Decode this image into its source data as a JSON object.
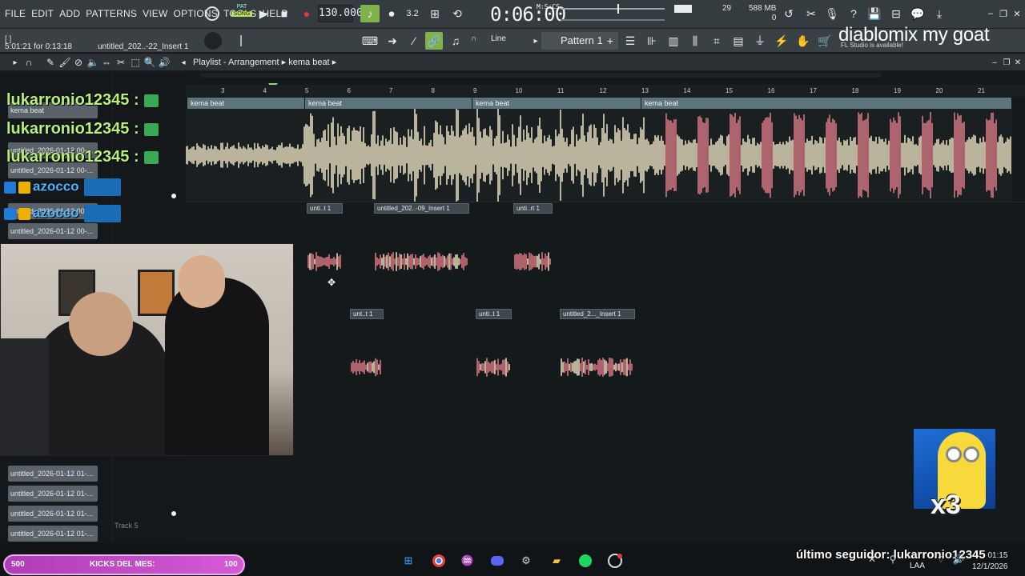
{
  "menu": [
    "FILE",
    "EDIT",
    "ADD",
    "PATTERNS",
    "VIEW",
    "OPTIONS",
    "TOOLS",
    "HELP"
  ],
  "transport": {
    "pat_label": "PAT",
    "song_label": "SONG",
    "tempo": "130.000",
    "time": "0:06:00",
    "time_unit": "M:S:CS"
  },
  "status": {
    "cpu": "29",
    "memory": "588 MB",
    "poly": "0"
  },
  "hint": {
    "line1": "[ ]",
    "line2": "5:01:21 for 0:13:18",
    "file": "untitled_202..-22_Insert 1"
  },
  "toolbar2": {
    "snap": "Line",
    "pattern": "Pattern 1"
  },
  "overlay": {
    "title": "diablomix my goat",
    "update_note": "FL Studio is available!"
  },
  "playlist": {
    "breadcrumb": "Playlist - Arrangement",
    "arrangement": "kema beat"
  },
  "ruler": [
    "3",
    "4",
    "5",
    "6",
    "7",
    "8",
    "9",
    "10",
    "11",
    "12",
    "13",
    "14",
    "15",
    "16",
    "17",
    "18",
    "19",
    "20",
    "21"
  ],
  "clips": {
    "pattern_name": "kema beat",
    "small": [
      "unti..t 1",
      "untitled_202..-09_Insert 1",
      "unti..rt 1",
      "unt..t 1",
      "unti..t 1",
      "untitled_2..._Insert 1"
    ]
  },
  "tracks": {
    "top_label": "kema beat",
    "items": [
      "untitled_2026-01-12 00-...",
      "untitled_2026-01-12 00-...",
      "untitled_2026-01-12 00-...",
      "untitled_2026-01-12 00-...",
      "untitled_2026-01-12 01-...",
      "untitled_2026-01-12 01-...",
      "untitled_2026-01-12 01-...",
      "untitled_2026-01-12 01-..."
    ],
    "track5": "Track 5"
  },
  "chat": {
    "user": "lukarronio12345 :",
    "user2": "azocco"
  },
  "stream": {
    "kicks_left": "500",
    "kicks_label": "KICKS DEL MES:",
    "kicks_right": "100",
    "follower": "último seguidor: lukarronio12345",
    "minion_count": "x3"
  },
  "system": {
    "time": "01:15",
    "date": "12/1/2026",
    "lang": "LAA"
  },
  "colors": {
    "accent_green": "#b7e25a",
    "clip_header": "#5e747d",
    "waveform_light": "#efe6c4",
    "waveform_red": "#e07b88",
    "kicks_bar": "#c149c6"
  }
}
